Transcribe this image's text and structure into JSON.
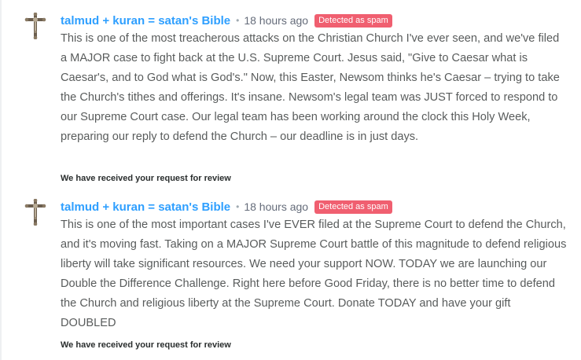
{
  "comments": [
    {
      "author": "talmud + kuran = satan's Bible",
      "separator": "•",
      "timestamp": "18 hours ago",
      "badge": "Detected as spam",
      "avatar_icon": "crucifix-icon",
      "body": "This is one of the most treacherous attacks on the Christian Church I've ever seen, and we've filed a MAJOR case to fight back at the U.S. Supreme Court. Jesus said, \"Give to Caesar what is Caesar's, and to God what is God's.\" Now, this Easter, Newsom thinks he's Caesar – trying to take the Church's tithes and offerings. It's insane. Newsom's legal team was JUST forced to respond to our Supreme Court case. Our legal team has been working around the clock this Holy Week, preparing our reply to defend the Church – our deadline is in just days.",
      "review_status": "We have received your request for review"
    },
    {
      "author": "talmud + kuran = satan's Bible",
      "separator": "•",
      "timestamp": "18 hours ago",
      "badge": "Detected as spam",
      "avatar_icon": "crucifix-icon",
      "body": "This is one of the most important cases I've EVER filed at the Supreme Court to defend the Church, and it's moving fast. Taking on a MAJOR Supreme Court battle of this magnitude to defend religious liberty will take significant resources. We need your support NOW. TODAY we are launching our Double the Difference Challenge. Right here before Good Friday, there is no better time to defend the Church and religious liberty at the Supreme Court. Donate TODAY and have your gift DOUBLED",
      "review_status": "We have received your request for review"
    }
  ],
  "colors": {
    "author": "#2e9fff",
    "badge": "#f05f70",
    "timestamp": "#656c7a",
    "body": "#2a2e2e"
  }
}
